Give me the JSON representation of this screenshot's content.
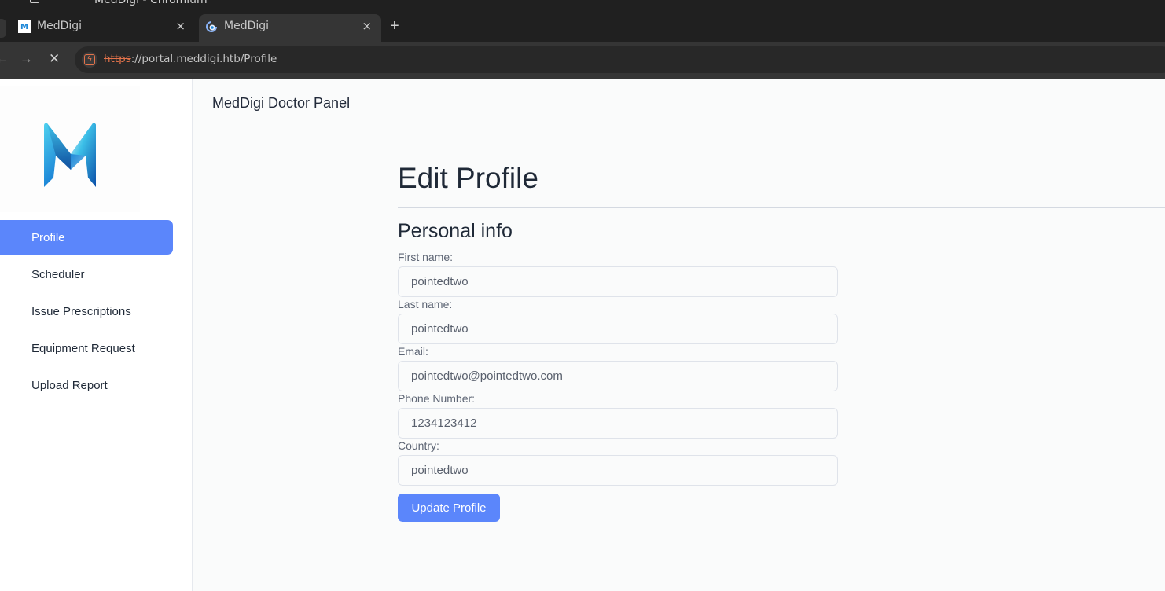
{
  "browser": {
    "window_title": "MedDigi - Chromium",
    "tabs": [
      {
        "label": "MedDigi",
        "favicon": "meddigi-favicon",
        "active": false
      },
      {
        "label": "MedDigi",
        "favicon": "loading-spinner",
        "active": true
      }
    ],
    "new_tab_label": "+",
    "close_label": "×",
    "url": {
      "scheme": "https",
      "rest": "://portal.meddigi.htb/Profile"
    },
    "nav": {
      "back": "←",
      "forward": "→",
      "stop": "✕"
    }
  },
  "sidebar": {
    "logo_alt": "MedDigi logo",
    "items": [
      {
        "label": "Profile",
        "active": true
      },
      {
        "label": "Scheduler",
        "active": false
      },
      {
        "label": "Issue Prescriptions",
        "active": false
      },
      {
        "label": "Equipment Request",
        "active": false
      },
      {
        "label": "Upload Report",
        "active": false
      }
    ]
  },
  "header": {
    "title": "MedDigi Doctor Panel"
  },
  "form": {
    "title": "Edit Profile",
    "section": "Personal info",
    "fields": [
      {
        "label": "First name:",
        "value": "pointedtwo"
      },
      {
        "label": "Last name:",
        "value": "pointedtwo"
      },
      {
        "label": "Email:",
        "value": "pointedtwo@pointedtwo.com"
      },
      {
        "label": "Phone Number:",
        "value": "1234123412"
      },
      {
        "label": "Country:",
        "value": "pointedtwo"
      }
    ],
    "submit_label": "Update Profile"
  },
  "colors": {
    "accent": "#5b86fb",
    "text_dark": "#1f2937",
    "insecure_scheme": "#e2724a"
  }
}
